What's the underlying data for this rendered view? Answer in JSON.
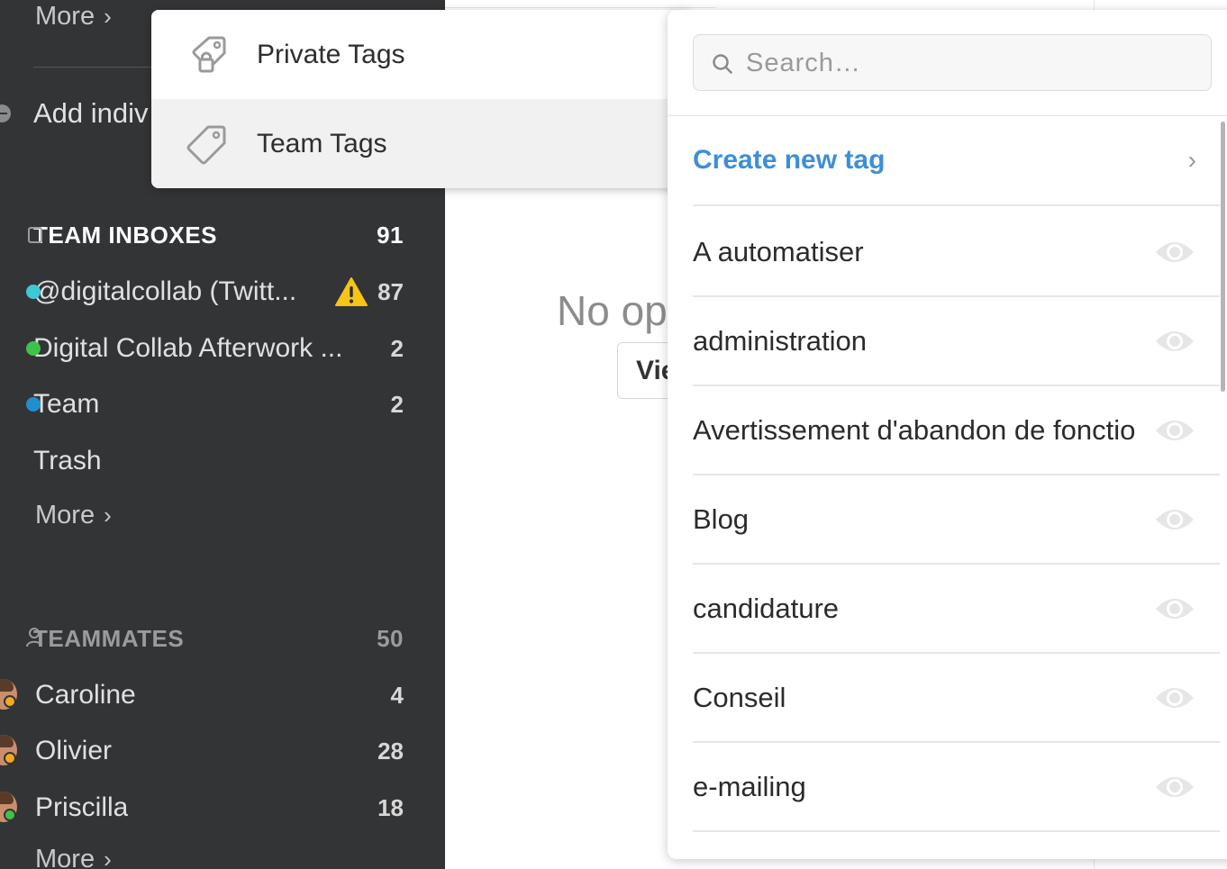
{
  "sidebar": {
    "more_top_label": "More",
    "add_label": "Add indiv",
    "team_inboxes": {
      "title": "TEAM INBOXES",
      "count": "91",
      "items": [
        {
          "name": "@digitalcollab (Twitt...",
          "count": "87",
          "dot_color": "#3ec7d6",
          "warning": true
        },
        {
          "name": "Digital Collab Afterwork ...",
          "count": "2",
          "dot_color": "#3fc24a"
        },
        {
          "name": "Team",
          "count": "2",
          "dot_color": "#1f8fce"
        },
        {
          "name": "Trash",
          "count": ""
        }
      ],
      "more_label": "More"
    },
    "teammates": {
      "title": "TEAMMATES",
      "count": "50",
      "items": [
        {
          "name": "Caroline",
          "count": "4",
          "status_color": "#f5a623"
        },
        {
          "name": "Olivier",
          "count": "28",
          "status_color": "#f5a623"
        },
        {
          "name": "Priscilla",
          "count": "18",
          "status_color": "#3fc24a"
        }
      ],
      "more_label": "More"
    }
  },
  "main": {
    "empty_text": "No ope",
    "view_button": "Vie"
  },
  "tag_type_menu": {
    "items": [
      {
        "label": "Private Tags",
        "icon": "lock-tag-icon"
      },
      {
        "label": "Team Tags",
        "icon": "tag-icon"
      }
    ]
  },
  "tag_panel": {
    "search_placeholder": "Search…",
    "create_label": "Create new tag",
    "tags": [
      "A automatiser",
      "administration",
      "Avertissement d'abandon de fonctionnalité",
      "Blog",
      "candidature",
      "Conseil",
      "e-mailing"
    ]
  },
  "colors": {
    "sidebar_bg": "#333436",
    "accent_link": "#3d8fd6",
    "warning": "#f5c518"
  }
}
